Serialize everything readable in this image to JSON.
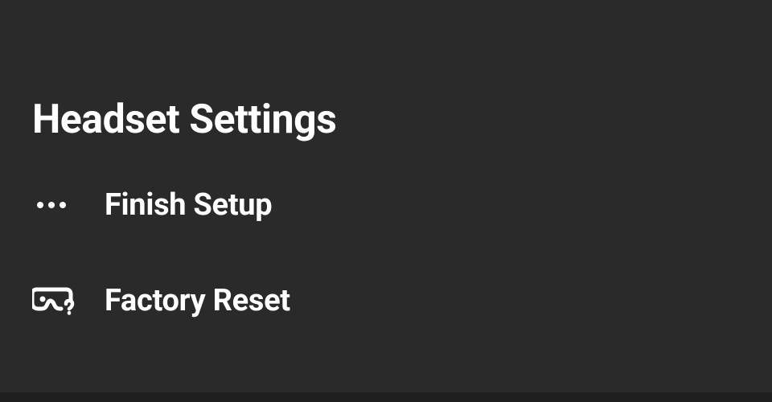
{
  "page": {
    "title": "Headset Settings"
  },
  "menu": {
    "items": [
      {
        "label": "Finish Setup",
        "icon": "more-dots-icon"
      },
      {
        "label": "Factory Reset",
        "icon": "headset-reset-icon"
      }
    ]
  }
}
